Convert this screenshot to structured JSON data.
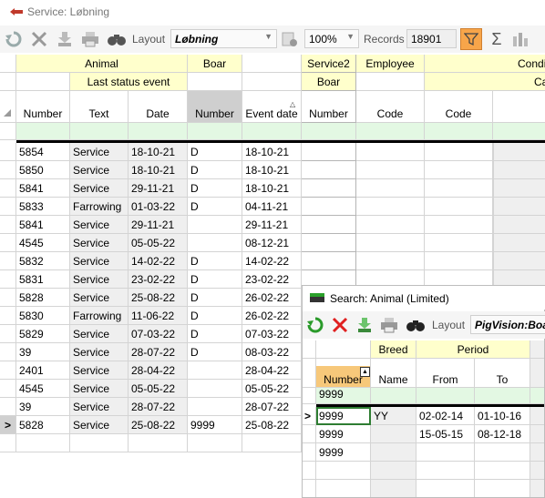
{
  "window": {
    "title": "Service: Løbning"
  },
  "toolbar": {
    "layout_label": "Layout",
    "layout_value": "Løbning",
    "zoom_value": "100%",
    "records_label": "Records",
    "records_value": "18901"
  },
  "grid": {
    "groups": {
      "animal": "Animal",
      "boar": "Boar",
      "service2": "Service2",
      "employee": "Employee",
      "condi": "Condi",
      "last_status": "Last status event",
      "boar_sub": "Boar",
      "ca": "Ca"
    },
    "columns": {
      "number": "Number",
      "text": "Text",
      "date": "Date",
      "boar_number": "Number",
      "event_date": "Event date",
      "s2_number": "Number",
      "code": "Code",
      "code2": "Code"
    },
    "rows": [
      {
        "number": "5854",
        "text": "Service",
        "date": "18-10-21",
        "boar": "D",
        "event_date": "18-10-21"
      },
      {
        "number": "5850",
        "text": "Service",
        "date": "18-10-21",
        "boar": "D",
        "event_date": "18-10-21"
      },
      {
        "number": "5841",
        "text": "Service",
        "date": "29-11-21",
        "boar": "D",
        "event_date": "18-10-21"
      },
      {
        "number": "5833",
        "text": "Farrowing",
        "date": "01-03-22",
        "boar": "D",
        "event_date": "04-11-21"
      },
      {
        "number": "5841",
        "text": "Service",
        "date": "29-11-21",
        "boar": "",
        "event_date": "29-11-21"
      },
      {
        "number": "4545",
        "text": "Service",
        "date": "05-05-22",
        "boar": "",
        "event_date": "08-12-21"
      },
      {
        "number": "5832",
        "text": "Service",
        "date": "14-02-22",
        "boar": "D",
        "event_date": "14-02-22"
      },
      {
        "number": "5831",
        "text": "Service",
        "date": "23-02-22",
        "boar": "D",
        "event_date": "23-02-22"
      },
      {
        "number": "5828",
        "text": "Service",
        "date": "25-08-22",
        "boar": "D",
        "event_date": "26-02-22"
      },
      {
        "number": "5830",
        "text": "Farrowing",
        "date": "11-06-22",
        "boar": "D",
        "event_date": "26-02-22"
      },
      {
        "number": "5829",
        "text": "Service",
        "date": "07-03-22",
        "boar": "D",
        "event_date": "07-03-22"
      },
      {
        "number": "39",
        "text": "Service",
        "date": "28-07-22",
        "boar": "D",
        "event_date": "08-03-22"
      },
      {
        "number": "2401",
        "text": "Service",
        "date": "28-04-22",
        "boar": "",
        "event_date": "28-04-22"
      },
      {
        "number": "4545",
        "text": "Service",
        "date": "05-05-22",
        "boar": "",
        "event_date": "05-05-22"
      },
      {
        "number": "39",
        "text": "Service",
        "date": "28-07-22",
        "boar": "",
        "event_date": "28-07-22"
      },
      {
        "number": "5828",
        "text": "Service",
        "date": "25-08-22",
        "boar": "9999",
        "event_date": "25-08-22"
      }
    ],
    "current_row_marker": ">"
  },
  "popup": {
    "title": "Search: Animal (Limited)",
    "layout_label": "Layout",
    "layout_value": "PigVision:Boa",
    "groups": {
      "breed": "Breed",
      "period": "Period"
    },
    "columns": {
      "number": "Number",
      "name": "Name",
      "from": "From",
      "to": "To"
    },
    "filter_value": "9999",
    "current_row_marker": ">",
    "rows": [
      {
        "number": "9999",
        "name": "YY",
        "from": "02-02-14",
        "to": "01-10-16"
      },
      {
        "number": "9999",
        "name": "",
        "from": "15-05-15",
        "to": "08-12-18"
      },
      {
        "number": "9999",
        "name": "",
        "from": "",
        "to": ""
      }
    ]
  },
  "colors": {
    "header_yellow": "#ffffcc",
    "filter_green": "#e3f8e3",
    "accent_orange": "#f7a54a",
    "selected_col": "#cfcfcf"
  }
}
